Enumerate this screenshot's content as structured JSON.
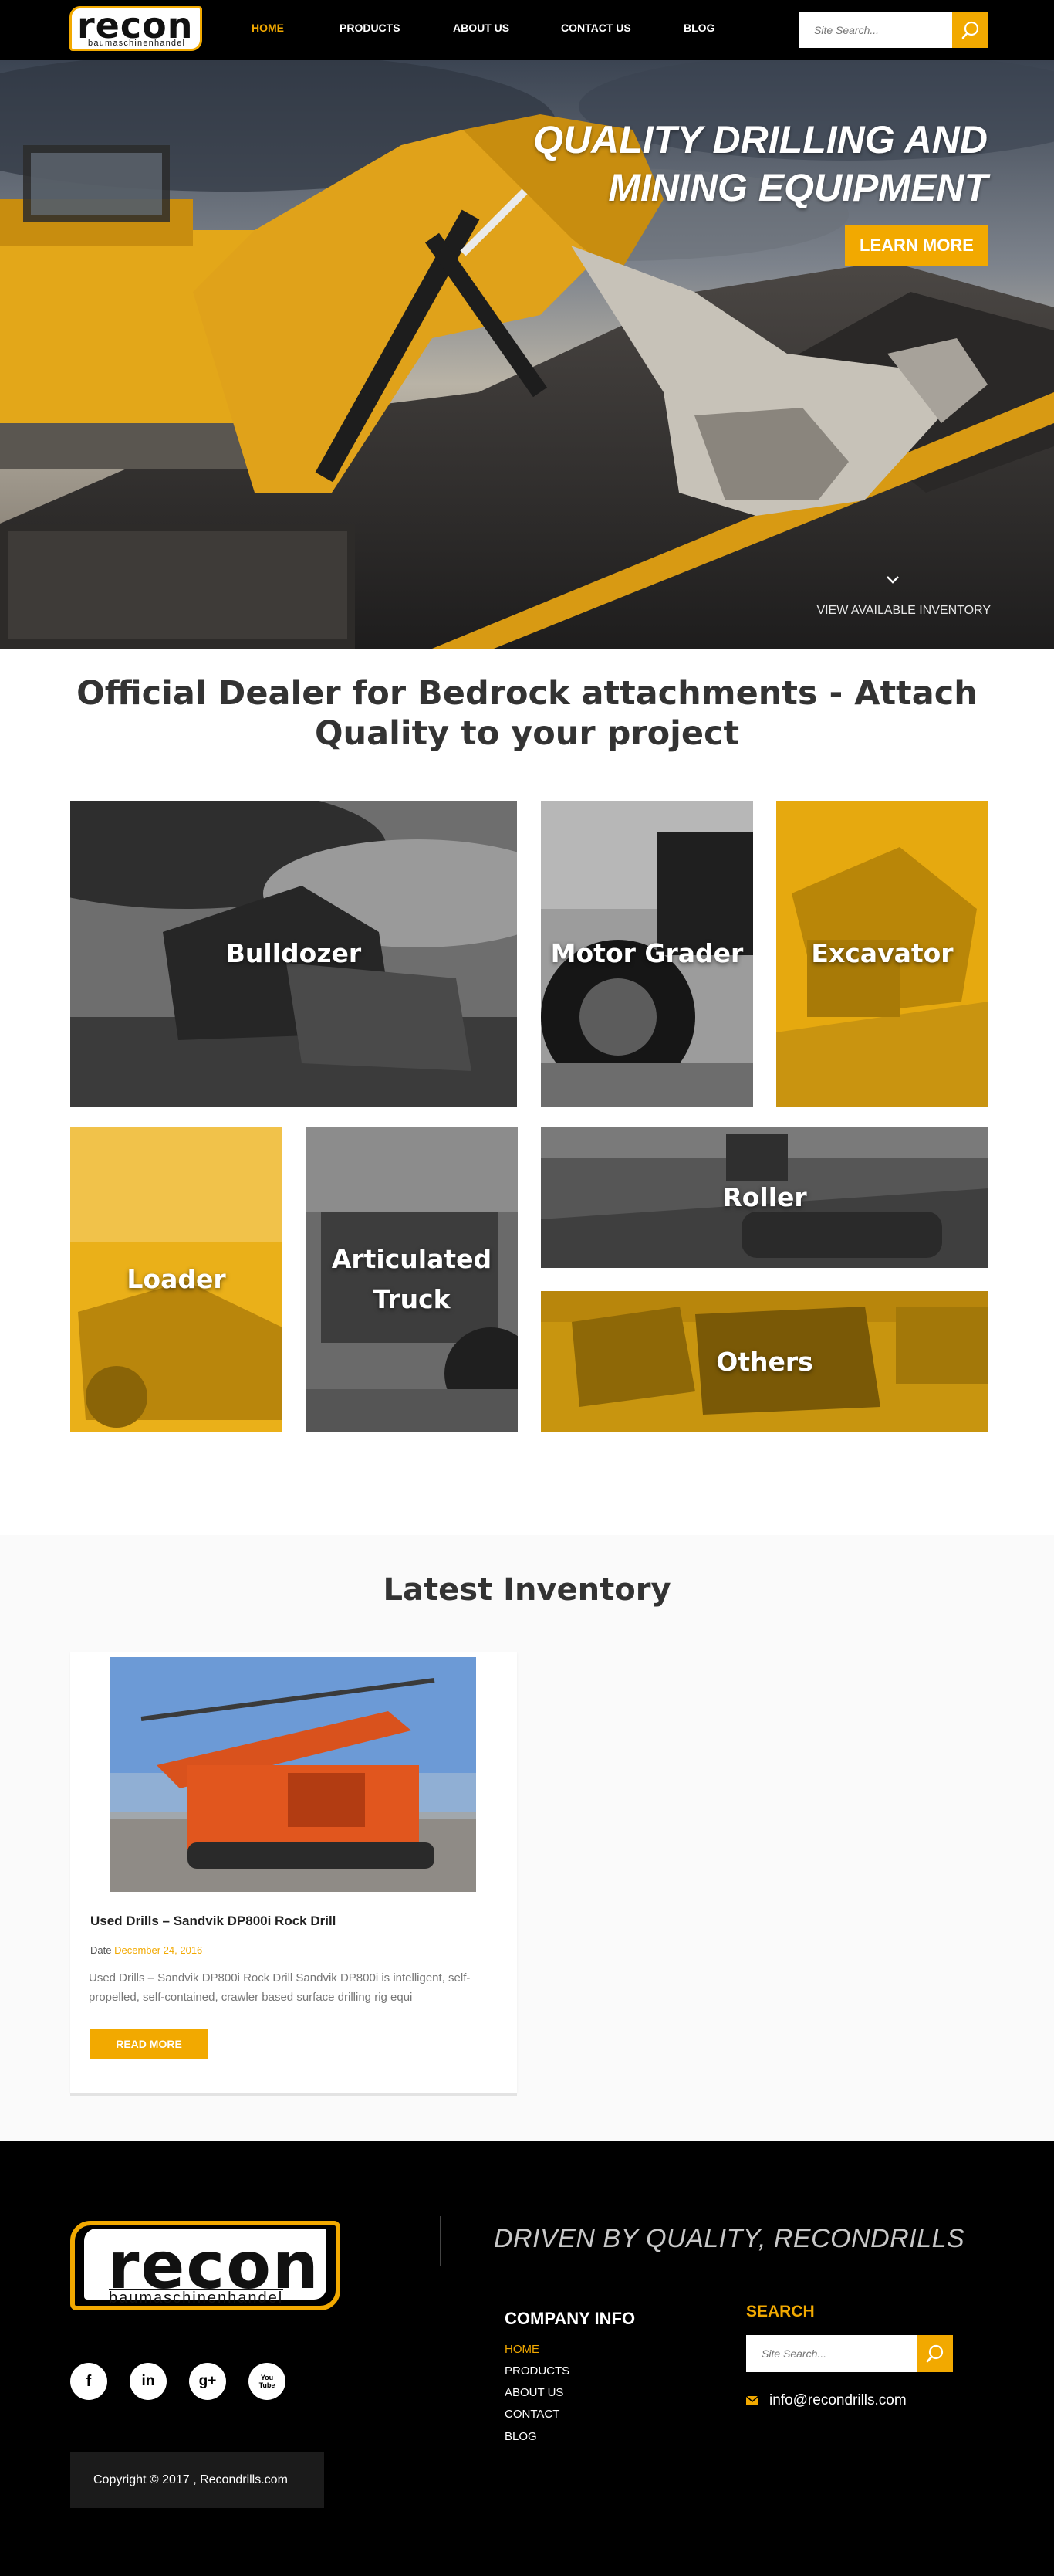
{
  "brand": {
    "logo_word": "recon",
    "logo_sub": "baumaschinenhandel"
  },
  "nav": {
    "items": [
      "HOME",
      "PRODUCTS",
      "ABOUT US",
      "CONTACT US",
      "BLOG"
    ],
    "search_placeholder": "Site Search..."
  },
  "hero": {
    "title_line1": "QUALITY DRILLING AND",
    "title_line2": "MINING EQUIPMENT",
    "cta": "LEARN MORE",
    "view_inventory": "VIEW AVAILABLE INVENTORY"
  },
  "dealer": {
    "title": "Official Dealer for Bedrock attachments - Attach Quality to your project",
    "categories": [
      "Bulldozer",
      "Motor Grader",
      "Excavator",
      "Loader",
      "Articulated Truck",
      "Roller",
      "Others"
    ]
  },
  "inventory": {
    "title": "Latest Inventory",
    "card": {
      "title": "Used Drills – Sandvik DP800i Rock Drill",
      "date_label": "Date",
      "date": "December 24, 2016",
      "excerpt": " Used Drills – Sandvik DP800i Rock Drill Sandvik DP800i is intelligent, self-propelled, self-contained, crawler based surface drilling rig equi",
      "button": "READ MORE"
    }
  },
  "footer": {
    "tagline": "DRIVEN BY QUALITY, RECONDRILLS",
    "company_title": "COMPANY INFO",
    "company_links": [
      "HOME",
      "PRODUCTS",
      "ABOUT US",
      "CONTACT",
      "BLOG"
    ],
    "search_title": "SEARCH",
    "search_placeholder": "Site Search...",
    "email": "info@recondrills.com",
    "copyright": "Copyright © 2017 , Recondrills.com",
    "social": [
      "f",
      "in",
      "g+",
      "You Tube"
    ]
  },
  "colors": {
    "accent": "#f2a900",
    "dark": "#000000"
  },
  "icons": [
    "search-icon",
    "chevron-down-icon",
    "facebook-icon",
    "linkedin-icon",
    "google-plus-icon",
    "youtube-icon",
    "mail-icon"
  ]
}
